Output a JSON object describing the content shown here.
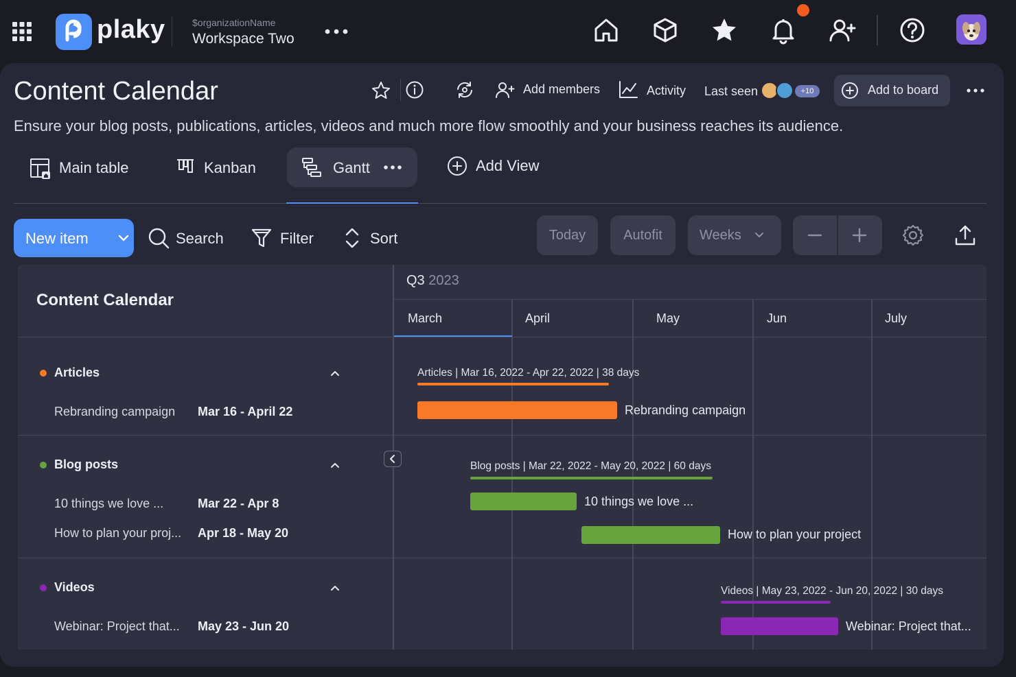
{
  "app": {
    "brand": "plaky",
    "org_name": "$organizationName",
    "workspace": "Workspace Two"
  },
  "topnav": {
    "icons": [
      "home-icon",
      "box-icon",
      "star-icon",
      "bell-icon",
      "add-user-icon",
      "help-icon"
    ],
    "notification_dot_color": "#f25c1f"
  },
  "board": {
    "title": "Content Calendar",
    "description": "Ensure your blog posts, publications, articles, videos and much more flow smoothly and your business reaches its audience.",
    "add_members": "Add members",
    "activity": "Activity",
    "last_seen": "Last seen",
    "last_seen_extra": "+10",
    "add_to_board": "Add to board"
  },
  "views": {
    "tabs": [
      {
        "label": "Main table",
        "icon": "table-icon"
      },
      {
        "label": "Kanban",
        "icon": "kanban-icon"
      },
      {
        "label": "Gantt",
        "icon": "gantt-icon",
        "active": true
      }
    ],
    "add_view": "Add View"
  },
  "toolbar": {
    "new_item": "New item",
    "search": "Search",
    "filter": "Filter",
    "sort": "Sort",
    "today": "Today",
    "autofit": "Autofit",
    "scale": "Weeks"
  },
  "gantt": {
    "left_title": "Content Calendar",
    "quarter": "Q3",
    "quarter_year": "2023",
    "months": [
      "March",
      "April",
      "May",
      "Jun",
      "July"
    ],
    "groups": [
      {
        "name": "Articles",
        "color": "#f87a28",
        "summary": "Articles | Mar 16, 2022 - Apr 22, 2022 | 38 days",
        "items": [
          {
            "name": "Rebranding campaign",
            "dates": "Mar 16 - April 22",
            "bar_label": "Rebranding campaign"
          }
        ]
      },
      {
        "name": "Blog posts",
        "color": "#68a23c",
        "summary": "Blog posts | Mar 22, 2022 - May 20, 2022 | 60 days",
        "items": [
          {
            "name": "10 things we love ...",
            "dates": "Mar 22 - Apr 8",
            "bar_label": "10 things we love ..."
          },
          {
            "name": "How to plan your proj...",
            "dates": "Apr 18 - May 20",
            "bar_label": "How to plan your project"
          }
        ]
      },
      {
        "name": "Videos",
        "color": "#8a28b5",
        "summary": "Videos | May 23, 2022 - Jun 20, 2022 | 30 days",
        "items": [
          {
            "name": "Webinar: Project that...",
            "dates": "May 23 - Jun 20",
            "bar_label": "Webinar: Project that..."
          }
        ]
      }
    ]
  },
  "colors": {
    "accent": "#4d8ef7",
    "background": "#1b1b24",
    "panel": "#262737"
  }
}
